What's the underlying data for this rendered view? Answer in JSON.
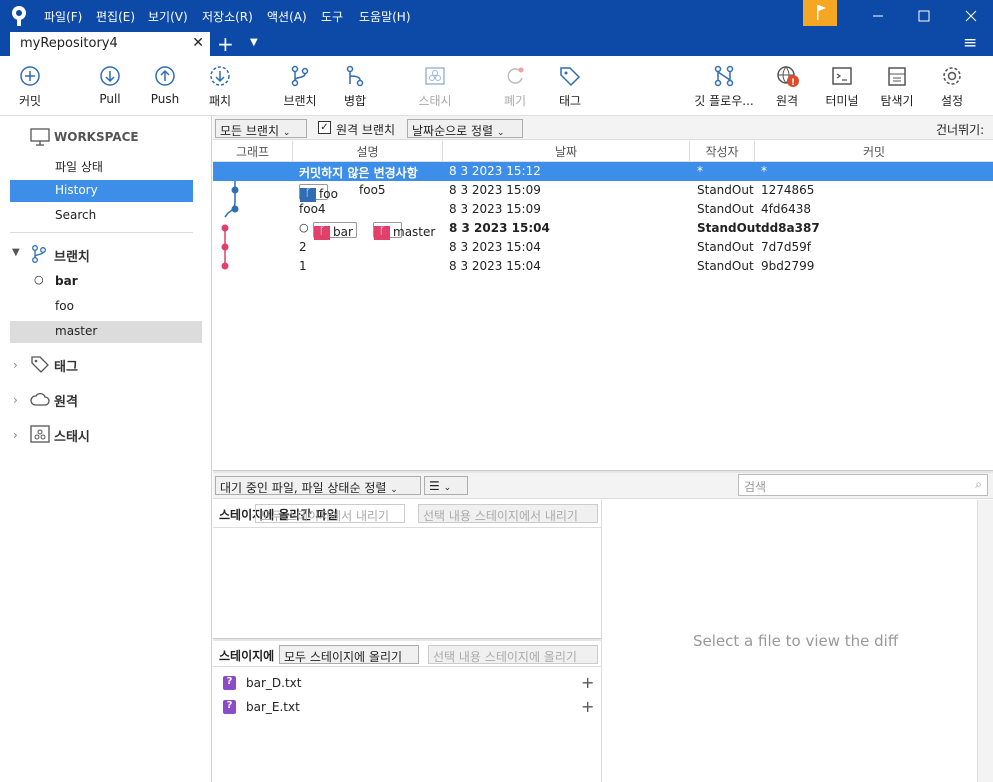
{
  "menu": [
    "파일(F)",
    "편집(E)",
    "보기(V)",
    "저장소(R)",
    "액션(A)",
    "도구",
    "도움말(H)"
  ],
  "tab": {
    "title": "myRepository4"
  },
  "toolbar": {
    "commit": "커밋",
    "pull": "Pull",
    "push": "Push",
    "fetch": "패치",
    "branch": "브랜치",
    "merge": "병합",
    "stash": "스태시",
    "discard": "폐기",
    "tag": "태그",
    "gitflow": "깃 플로우...",
    "remote": "원격",
    "terminal": "터미널",
    "explorer": "탐색기",
    "settings": "설정"
  },
  "sidebar": {
    "workspace": "WORKSPACE",
    "ws_items": [
      "파일 상태",
      "History",
      "Search"
    ],
    "branches_label": "브랜치",
    "branches": [
      "bar",
      "foo",
      "master"
    ],
    "tags_label": "태그",
    "remotes_label": "원격",
    "stash_label": "스태시"
  },
  "filter": {
    "all_branches": "모든 브랜치",
    "remote_branches": "원격 브랜치",
    "sort": "날짜순으로 정렬",
    "skip": "건너뛰기:"
  },
  "columns": [
    "그래프",
    "설명",
    "날짜",
    "작성자",
    "커밋"
  ],
  "commits": [
    {
      "desc": "커밋하지 않은 변경사항",
      "date": "8 3 2023 15:12",
      "author": "*",
      "hash": "*"
    },
    {
      "desc": "foo5",
      "badge": "foo",
      "date": "8 3 2023 15:09",
      "author": "StandOut",
      "hash": "1274865"
    },
    {
      "desc": "foo4",
      "date": "8 3 2023 15:09",
      "author": "StandOut",
      "hash": "4fd6438"
    },
    {
      "badge1": "bar",
      "badge2": "master",
      "date": "8 3 2023 15:04",
      "author": "StandOut",
      "hash": "dd8a387"
    },
    {
      "desc": "2",
      "date": "8 3 2023 15:04",
      "author": "StandOut",
      "hash": "7d7d59f"
    },
    {
      "desc": "1",
      "date": "8 3 2023 15:04",
      "author": "StandOut",
      "hash": "9bd2799"
    }
  ],
  "pending": {
    "sort": "대기 중인 파일, 파일 상태순 정렬",
    "search_placeholder": "검색",
    "staged_label": "스테이지에 올라간 파일",
    "unstage_all": "모두 스테이지에서 내리기",
    "unstage_selected": "선택 내용 스테이지에서 내리기",
    "unstaged_label": "스테이지에",
    "stage_all": "모두 스테이지에 올리기",
    "stage_selected": "선택 내용 스테이지에 올리기",
    "files": [
      "bar_D.txt",
      "bar_E.txt"
    ],
    "diff_hint": "Select a file to view the diff"
  },
  "colors": {
    "accent": "#0d4aa8",
    "selection": "#3d8ee8",
    "bar_badge": "#e0406a",
    "foo_badge": "#2f6db5",
    "warn": "#f5a623"
  }
}
